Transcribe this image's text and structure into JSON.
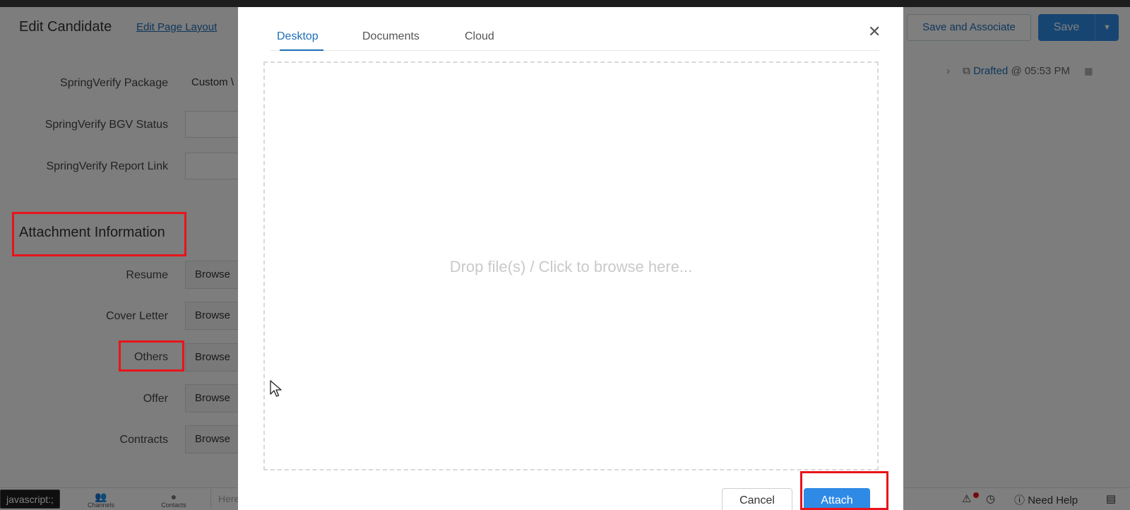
{
  "page": {
    "title": "Edit Candidate",
    "edit_layout_link": "Edit Page Layout",
    "save_and_associate": "Save and Associate",
    "save": "Save",
    "draft_status": "Drafted",
    "draft_time": "@ 05:53 PM"
  },
  "fields": [
    {
      "label": "SpringVerify Package",
      "value": "Custom \\"
    },
    {
      "label": "SpringVerify BGV Status",
      "value": ""
    },
    {
      "label": "SpringVerify Report Link",
      "value": ""
    }
  ],
  "attachments": {
    "section_title": "Attachment Information",
    "browse_label": "Browse",
    "rows": [
      "Resume",
      "Cover Letter",
      "Others",
      "Offer",
      "Contracts"
    ]
  },
  "bottom_bar": {
    "status_link": "javascript:;",
    "channels": "Channels",
    "contacts": "Contacts",
    "search_placeholder": "Here",
    "need_help": "Need Help"
  },
  "modal": {
    "tabs": [
      "Desktop",
      "Documents",
      "Cloud"
    ],
    "active_tab": "Desktop",
    "drop_text": "Drop file(s) / Click to browse here...",
    "cancel": "Cancel",
    "attach": "Attach"
  },
  "colors": {
    "accent": "#2f8ae5",
    "link": "#1f6fb6",
    "highlight": "#e8141b"
  }
}
